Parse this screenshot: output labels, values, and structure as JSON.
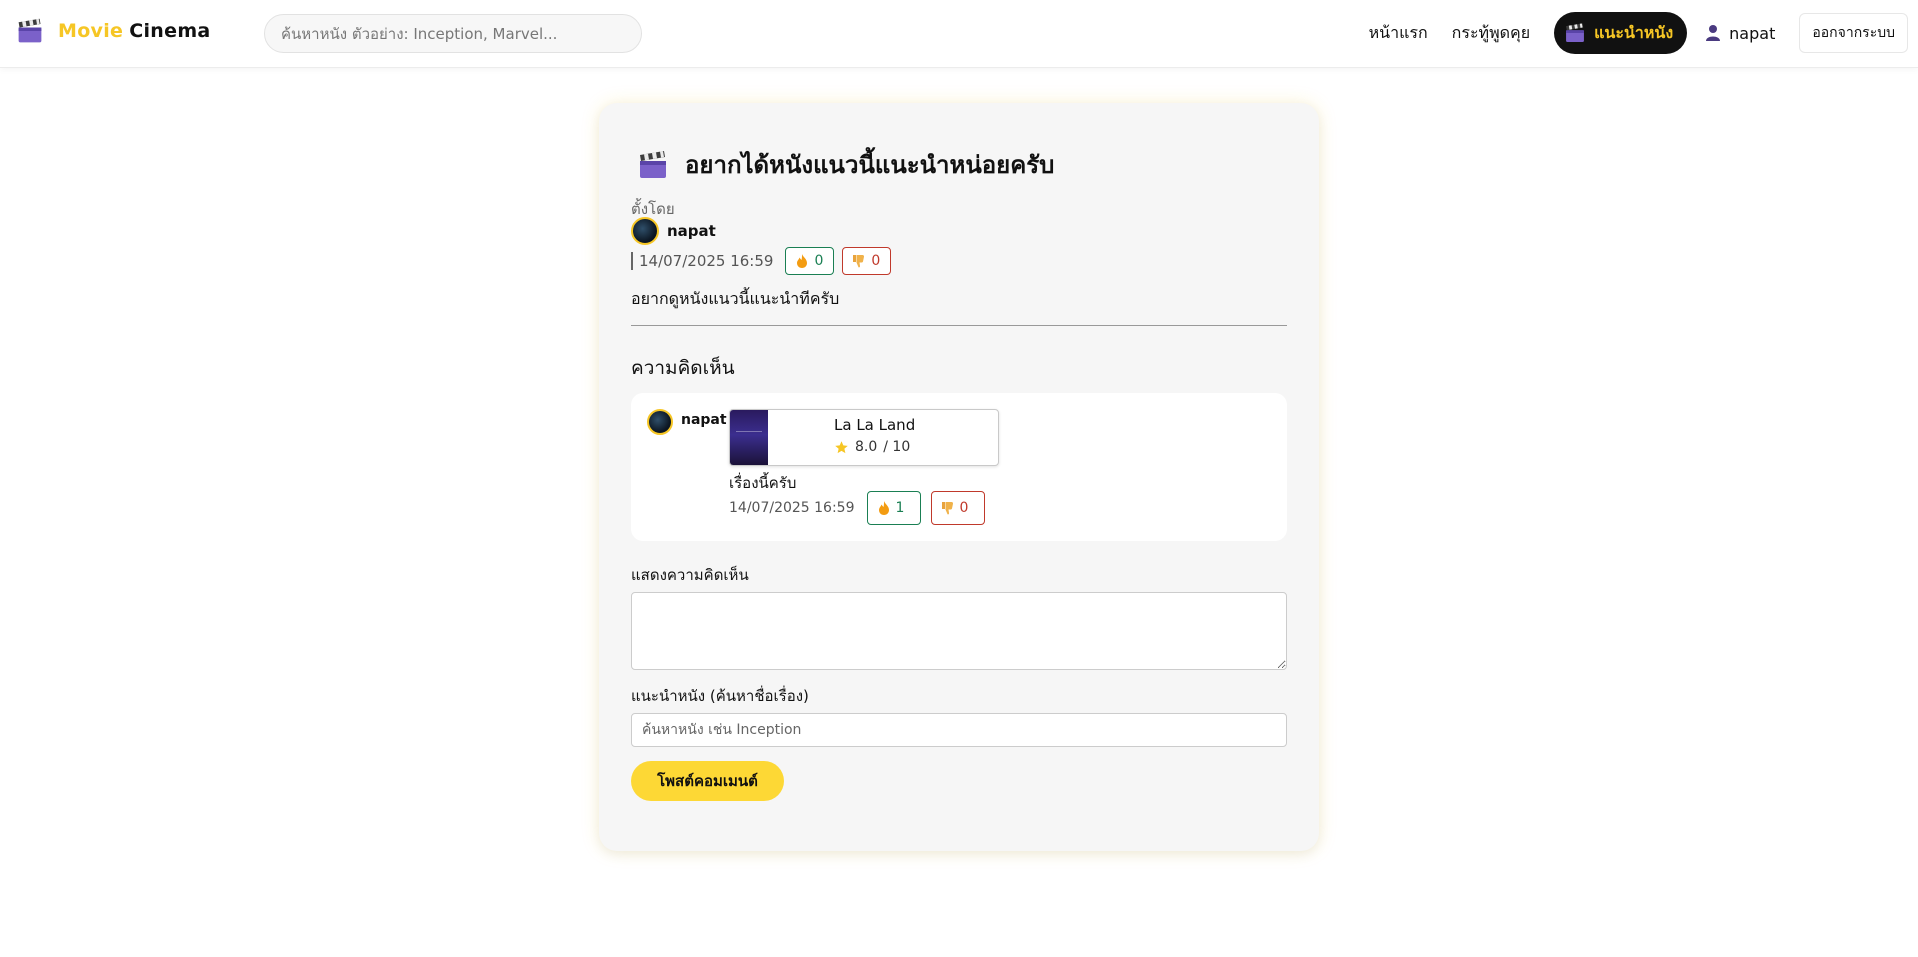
{
  "nav": {
    "brand_part1": "Movie",
    "brand_part2": "Cinema",
    "search_placeholder": "ค้นหาหนัง ตัวอย่าง: Inception, Marvel...",
    "links": {
      "home": "หน้าแรก",
      "forum": "กระทู้พูดคุย",
      "recommend": "แนะนำหนัง"
    },
    "username": "napat",
    "logout": "ออกจากระบบ"
  },
  "post": {
    "title": "อยากได้หนังแนวนี้แนะนำหน่อยครับ",
    "posted_by_label": "ตั้งโดย",
    "author": "napat",
    "timestamp": "14/07/2025 16:59",
    "likes": "0",
    "dislikes": "0",
    "body": "อยากดูหนังแนวนี้แนะนำทีครับ"
  },
  "comments_heading": "ความคิดเห็น",
  "comments": [
    {
      "author": "napat",
      "movie_title": "La La Land",
      "movie_rating": "8.0",
      "movie_rating_max": "/ 10",
      "body": "เรื่องนี้ครับ",
      "timestamp": "14/07/2025 16:59",
      "likes": "1",
      "dislikes": "0"
    }
  ],
  "form": {
    "comment_label": "แสดงความคิดเห็น",
    "comment_value": "",
    "recommend_label": "แนะนำหนัง (ค้นหาชื่อเรื่อง)",
    "recommend_placeholder": "ค้นหาหนัง เช่น Inception",
    "submit": "โพสต์คอมเมนต์"
  },
  "colors": {
    "accent": "#f6c625",
    "button": "#fdd835",
    "like": "#1a7f53",
    "dislike": "#c0392b"
  },
  "icons": {
    "brand": "clapperboard-icon",
    "title": "clapperboard-icon",
    "nav_recommend": "clapperboard-icon",
    "user": "user-icon",
    "like": "fire-icon",
    "dislike": "thumbs-down-icon",
    "rating": "star-icon"
  }
}
